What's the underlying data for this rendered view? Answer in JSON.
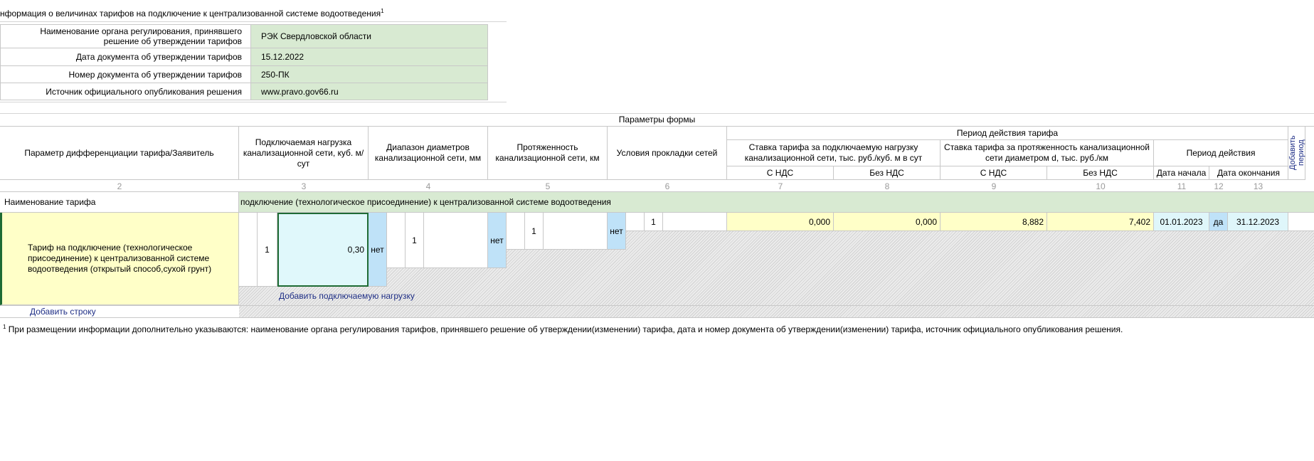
{
  "title": {
    "text": "нформация о величинах тарифов на подключение к централизованной системе водоотведения",
    "footnote_mark": "1"
  },
  "info": [
    {
      "label": "Наименование органа регулирования, принявшего решение об утверждении тарифов",
      "value": "РЭК Свердловской области"
    },
    {
      "label": "Дата документа об утверждении тарифов",
      "value": "15.12.2022"
    },
    {
      "label": "Номер документа об утверждении тарифов",
      "value": "250-ПК"
    },
    {
      "label": "Источник официального опубликования решения",
      "value": "www.pravo.gov66.ru"
    }
  ],
  "form": {
    "params_title": "Параметры формы",
    "headers": {
      "param": "Параметр дифференциации тарифа/Заявитель",
      "load": "Подключаемая нагрузка канализационной сети, куб. м/сут",
      "diam": "Диапазон диаметров канализационной сети, мм",
      "length": "Протяженность канализационной сети, км",
      "cond": "Условия прокладки сетей",
      "period_group": "Период действия тарифа",
      "rate_load": "Ставка тарифа за подключаемую нагрузку канализационной сети, тыс. руб./куб. м в сут",
      "rate_len": "Ставка тарифа за протяженность канализационной сети диаметром d, тыс. руб./км",
      "period": "Период действия",
      "with_vat": "С НДС",
      "without_vat": "Без НДС",
      "with_vat2": "С НДС",
      "without_vat2": "Без НДС",
      "date_start": "Дата начала",
      "date_end": "Дата окончания",
      "add_period": "Добавить период"
    },
    "col_numbers": [
      "2",
      "3",
      "4",
      "5",
      "6",
      "7",
      "8",
      "9",
      "10",
      "11",
      "12",
      "13"
    ],
    "tariff_name_label": "Наименование тарифа",
    "tariff_name_value": "подключение (технологическое присоединение) к централизованной системе водоотведения",
    "row": {
      "desc": "Тариф на подключение (технологическое присоединение) к централизованной системе водоотведения (открытый способ,сухой грунт)",
      "idx1": "1",
      "load": "0,30",
      "load_flag": "нет",
      "idx2": "1",
      "diam_flag": "нет",
      "idx3": "1",
      "len_flag": "нет",
      "idx4": "1",
      "v7": "0,000",
      "v8": "0,000",
      "v9": "8,882",
      "v10": "7,402",
      "date_start": "01.01.2023",
      "flag12": "да",
      "date_end": "31.12.2023"
    },
    "add_load": "Добавить подключаемую нагрузку",
    "add_row": "Добавить строку"
  },
  "footnote": {
    "mark": "1",
    "text": "При размещении информации дополнительно указываются: наименование органа регулирования тарифов, принявшего решение об утверждении(изменении) тарифа, дата и номер документа об утверждении(изменении) тарифа, источник официального опубликования решения."
  }
}
